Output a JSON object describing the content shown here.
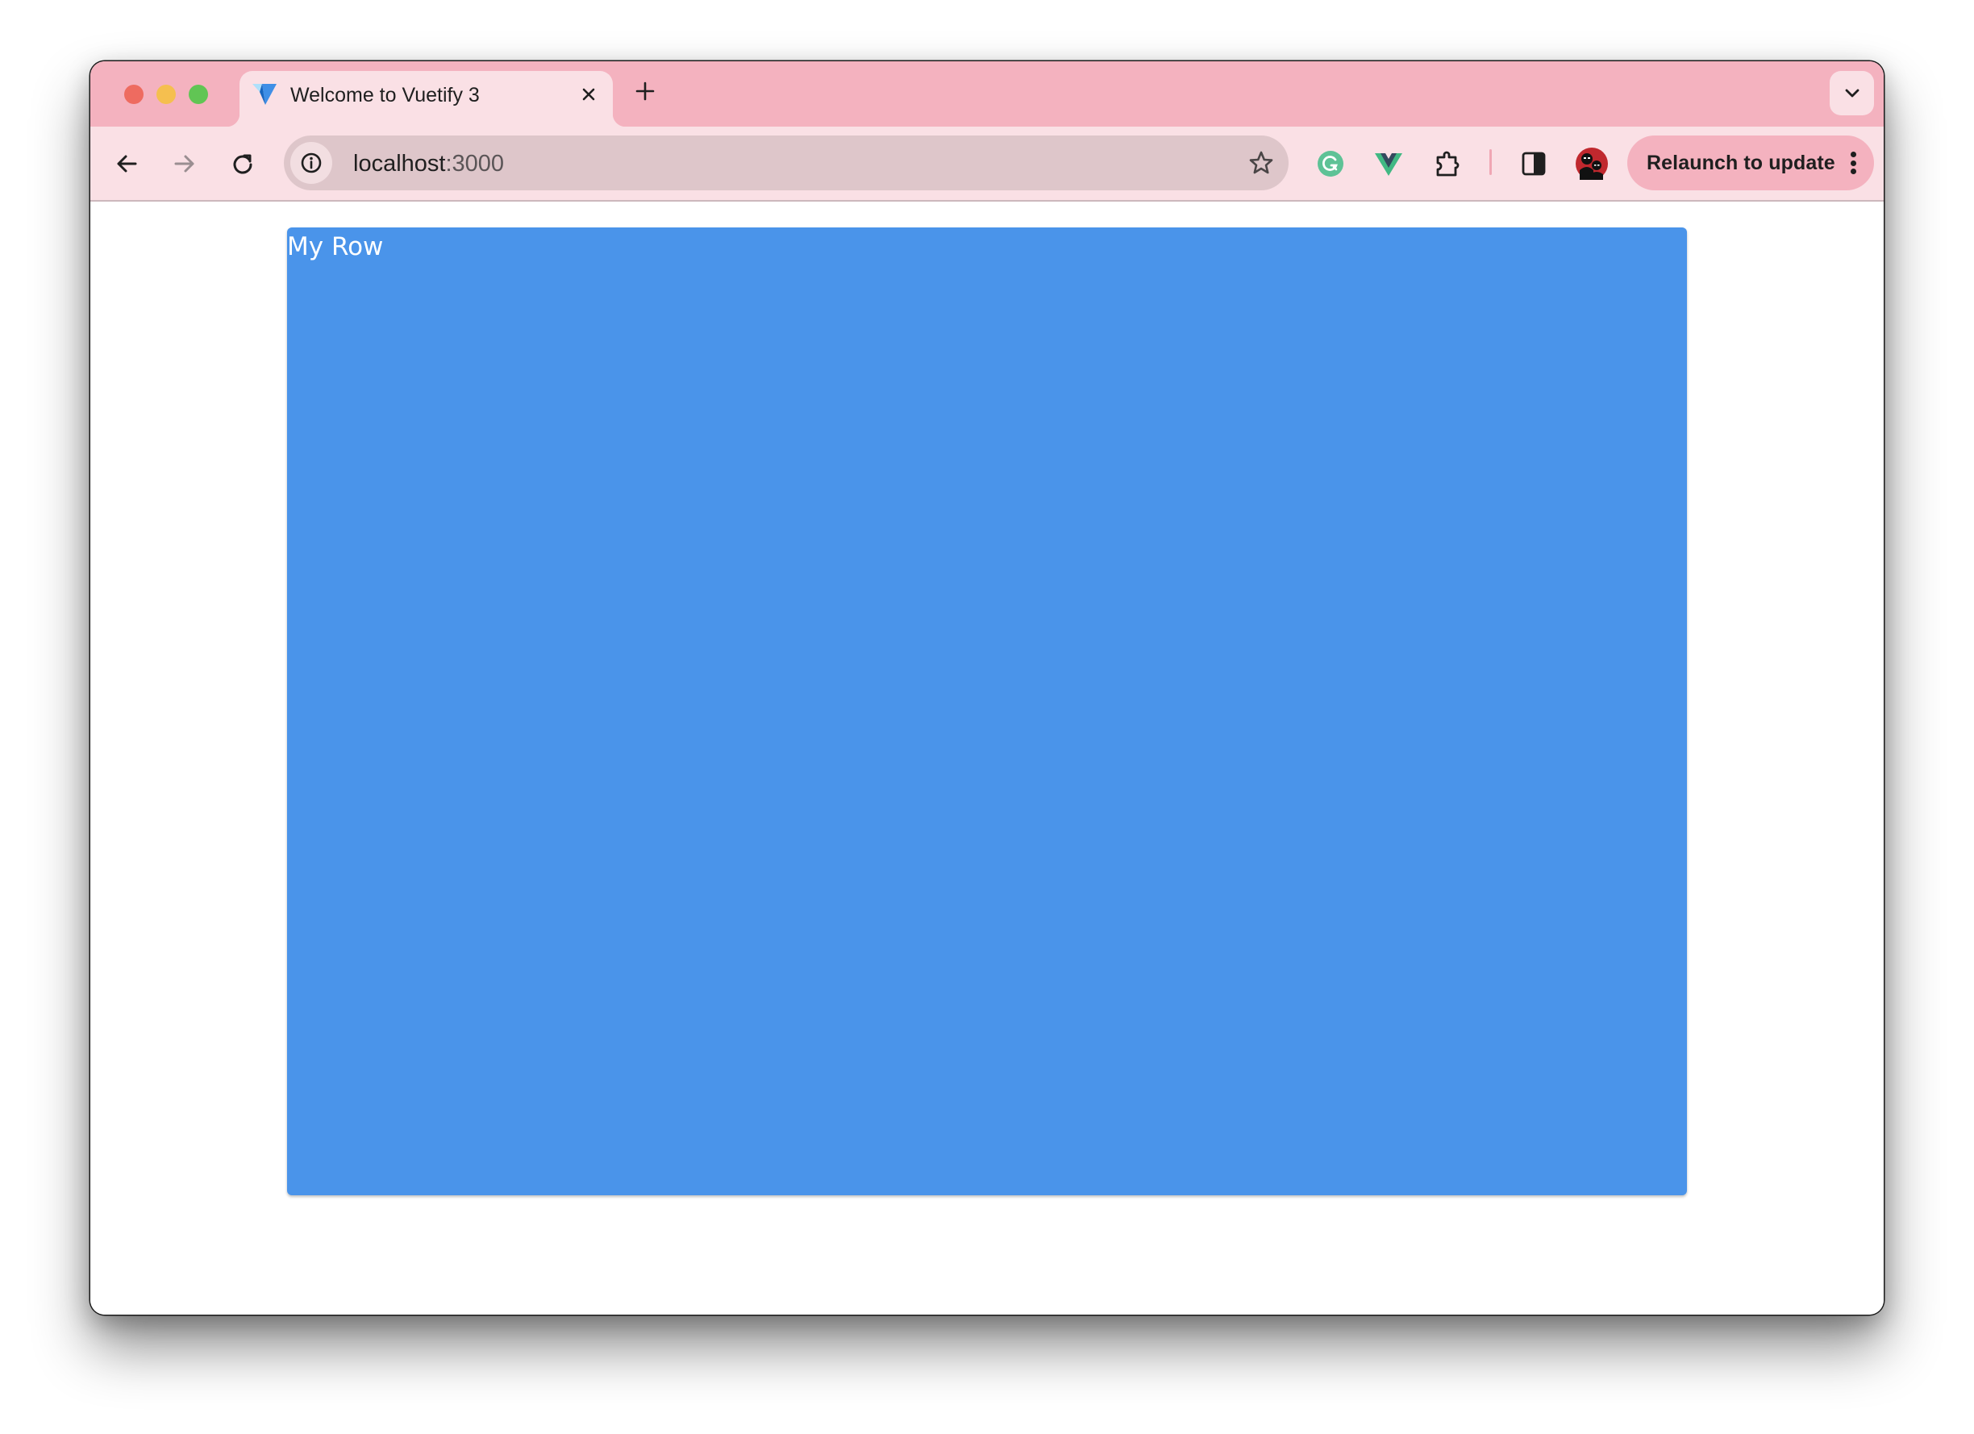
{
  "browser": {
    "tabs": [
      {
        "title": "Welcome to Vuetify 3",
        "favicon": "vuetify-logo-icon",
        "active": true
      }
    ],
    "toolbar": {
      "back": "arrow-left-icon",
      "forward": "arrow-right-icon",
      "reload": "reload-icon",
      "site_info": "info-icon",
      "url_host": "localhost",
      "url_port": ":3000",
      "bookmark": "star-icon",
      "extensions": [
        {
          "name": "Grammarly",
          "icon": "grammarly-icon",
          "color": "#5ec296"
        },
        {
          "name": "Vue.js devtools",
          "icon": "vue-icon",
          "color": "#41b883"
        },
        {
          "name": "Extensions",
          "icon": "puzzle-icon"
        }
      ],
      "side_panel": "side-panel-icon",
      "profile": "avatar",
      "relaunch_label": "Relaunch to update",
      "menu": "more-vert-icon"
    },
    "colors": {
      "frame": "#f4b2bf",
      "toolbar": "#fae0e5",
      "omnibox": "#dec6ca"
    }
  },
  "page": {
    "row": {
      "label": "My Row",
      "color": "#4a94ea"
    }
  }
}
